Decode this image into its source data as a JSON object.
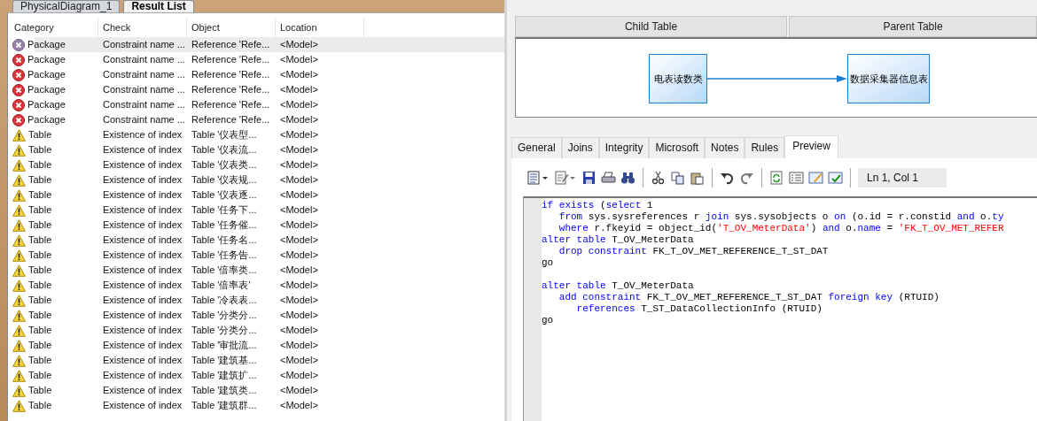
{
  "document_tabs": [
    {
      "label": "PhysicalDiagram_1",
      "selected": false
    },
    {
      "label": "Result List",
      "selected": true
    }
  ],
  "result_list": {
    "columns": [
      "Category",
      "Check",
      "Object",
      "Location"
    ],
    "rows": [
      {
        "kind": "error",
        "category": "Package",
        "check": "Constraint name ...",
        "object": "Reference 'Refe...",
        "location": "<Model>",
        "selected": true
      },
      {
        "kind": "error",
        "category": "Package",
        "check": "Constraint name ...",
        "object": "Reference 'Refe...",
        "location": "<Model>",
        "selected": false
      },
      {
        "kind": "error",
        "category": "Package",
        "check": "Constraint name ...",
        "object": "Reference 'Refe...",
        "location": "<Model>",
        "selected": false
      },
      {
        "kind": "error",
        "category": "Package",
        "check": "Constraint name ...",
        "object": "Reference 'Refe...",
        "location": "<Model>",
        "selected": false
      },
      {
        "kind": "error",
        "category": "Package",
        "check": "Constraint name ...",
        "object": "Reference 'Refe...",
        "location": "<Model>",
        "selected": false
      },
      {
        "kind": "error",
        "category": "Package",
        "check": "Constraint name ...",
        "object": "Reference 'Refe...",
        "location": "<Model>",
        "selected": false
      },
      {
        "kind": "warning",
        "category": "Table",
        "check": "Existence of index",
        "object": "Table '仪表型...",
        "location": "<Model>",
        "selected": false
      },
      {
        "kind": "warning",
        "category": "Table",
        "check": "Existence of index",
        "object": "Table '仪表流...",
        "location": "<Model>",
        "selected": false
      },
      {
        "kind": "warning",
        "category": "Table",
        "check": "Existence of index",
        "object": "Table '仪表类...",
        "location": "<Model>",
        "selected": false
      },
      {
        "kind": "warning",
        "category": "Table",
        "check": "Existence of index",
        "object": "Table '仪表规...",
        "location": "<Model>",
        "selected": false
      },
      {
        "kind": "warning",
        "category": "Table",
        "check": "Existence of index",
        "object": "Table '仪表逐...",
        "location": "<Model>",
        "selected": false
      },
      {
        "kind": "warning",
        "category": "Table",
        "check": "Existence of index",
        "object": "Table '任务下...",
        "location": "<Model>",
        "selected": false
      },
      {
        "kind": "warning",
        "category": "Table",
        "check": "Existence of index",
        "object": "Table '任务催...",
        "location": "<Model>",
        "selected": false
      },
      {
        "kind": "warning",
        "category": "Table",
        "check": "Existence of index",
        "object": "Table '任务名...",
        "location": "<Model>",
        "selected": false
      },
      {
        "kind": "warning",
        "category": "Table",
        "check": "Existence of index",
        "object": "Table '任务告...",
        "location": "<Model>",
        "selected": false
      },
      {
        "kind": "warning",
        "category": "Table",
        "check": "Existence of index",
        "object": "Table '倍率类...",
        "location": "<Model>",
        "selected": false
      },
      {
        "kind": "warning",
        "category": "Table",
        "check": "Existence of index",
        "object": "Table '倍率表'",
        "location": "<Model>",
        "selected": false
      },
      {
        "kind": "warning",
        "category": "Table",
        "check": "Existence of index",
        "object": "Table '冷表表...",
        "location": "<Model>",
        "selected": false
      },
      {
        "kind": "warning",
        "category": "Table",
        "check": "Existence of index",
        "object": "Table '分类分...",
        "location": "<Model>",
        "selected": false
      },
      {
        "kind": "warning",
        "category": "Table",
        "check": "Existence of index",
        "object": "Table '分类分...",
        "location": "<Model>",
        "selected": false
      },
      {
        "kind": "warning",
        "category": "Table",
        "check": "Existence of index",
        "object": "Table '审批流...",
        "location": "<Model>",
        "selected": false
      },
      {
        "kind": "warning",
        "category": "Table",
        "check": "Existence of index",
        "object": "Table '建筑基...",
        "location": "<Model>",
        "selected": false
      },
      {
        "kind": "warning",
        "category": "Table",
        "check": "Existence of index",
        "object": "Table '建筑扩...",
        "location": "<Model>",
        "selected": false
      },
      {
        "kind": "warning",
        "category": "Table",
        "check": "Existence of index",
        "object": "Table '建筑类...",
        "location": "<Model>",
        "selected": false
      },
      {
        "kind": "warning",
        "category": "Table",
        "check": "Existence of index",
        "object": "Table '建筑群...",
        "location": "<Model>",
        "selected": false
      }
    ]
  },
  "reference": {
    "headers": [
      "Child Table",
      "Parent Table"
    ],
    "child_table": "电表读数类",
    "parent_table": "数据采集器信息表"
  },
  "property_tabs": [
    {
      "label": "General",
      "selected": false
    },
    {
      "label": "Joins",
      "selected": false
    },
    {
      "label": "Integrity",
      "selected": false
    },
    {
      "label": "Microsoft",
      "selected": false
    },
    {
      "label": "Notes",
      "selected": false
    },
    {
      "label": "Rules",
      "selected": false
    },
    {
      "label": "Preview",
      "selected": true
    }
  ],
  "cursor_position": "Ln 1, Col 1",
  "code_lines": [
    {
      "kind": "code",
      "tokens": [
        {
          "kind": "keyword",
          "text": "if exists"
        },
        {
          "kind": "plain",
          "text": " ("
        },
        {
          "kind": "keyword",
          "text": "select"
        },
        {
          "kind": "plain",
          "text": " 1"
        }
      ]
    },
    {
      "kind": "code",
      "tokens": [
        {
          "kind": "keyword",
          "text": "   from"
        },
        {
          "kind": "plain",
          "text": " sys.sysreferences r "
        },
        {
          "kind": "keyword",
          "text": "join"
        },
        {
          "kind": "plain",
          "text": " sys.sysobjects o "
        },
        {
          "kind": "keyword",
          "text": "on"
        },
        {
          "kind": "plain",
          "text": " (o.id = r.constid "
        },
        {
          "kind": "keyword",
          "text": "and"
        },
        {
          "kind": "plain",
          "text": " o."
        },
        {
          "kind": "keyword",
          "text": "ty"
        }
      ]
    },
    {
      "kind": "code",
      "tokens": [
        {
          "kind": "keyword",
          "text": "   where"
        },
        {
          "kind": "plain",
          "text": " r.fkeyid = object_id("
        },
        {
          "kind": "string",
          "text": "'T_OV_MeterData'"
        },
        {
          "kind": "plain",
          "text": ") "
        },
        {
          "kind": "keyword",
          "text": "and"
        },
        {
          "kind": "plain",
          "text": " o."
        },
        {
          "kind": "keyword",
          "text": "name"
        },
        {
          "kind": "plain",
          "text": " = "
        },
        {
          "kind": "string",
          "text": "'FK_T_OV_MET_REFER"
        }
      ]
    },
    {
      "kind": "code",
      "tokens": [
        {
          "kind": "keyword",
          "text": "alter table"
        },
        {
          "kind": "plain",
          "text": " T_OV_MeterData"
        }
      ]
    },
    {
      "kind": "code",
      "tokens": [
        {
          "kind": "keyword",
          "text": "   drop constraint"
        },
        {
          "kind": "plain",
          "text": " FK_T_OV_MET_REFERENCE_T_ST_DAT"
        }
      ]
    },
    {
      "kind": "code",
      "tokens": [
        {
          "kind": "plain",
          "text": "go"
        }
      ]
    },
    {
      "kind": "blank"
    },
    {
      "kind": "code",
      "tokens": [
        {
          "kind": "keyword",
          "text": "alter table"
        },
        {
          "kind": "plain",
          "text": " T_OV_MeterData"
        }
      ]
    },
    {
      "kind": "code",
      "tokens": [
        {
          "kind": "keyword",
          "text": "   add constraint"
        },
        {
          "kind": "plain",
          "text": " FK_T_OV_MET_REFERENCE_T_ST_DAT "
        },
        {
          "kind": "keyword",
          "text": "foreign key"
        },
        {
          "kind": "plain",
          "text": " (RTUID)"
        }
      ]
    },
    {
      "kind": "code",
      "tokens": [
        {
          "kind": "keyword",
          "text": "      references"
        },
        {
          "kind": "plain",
          "text": " T_ST_DataCollectionInfo (RTUID)"
        }
      ]
    },
    {
      "kind": "code",
      "tokens": [
        {
          "kind": "plain",
          "text": "go"
        }
      ]
    }
  ]
}
